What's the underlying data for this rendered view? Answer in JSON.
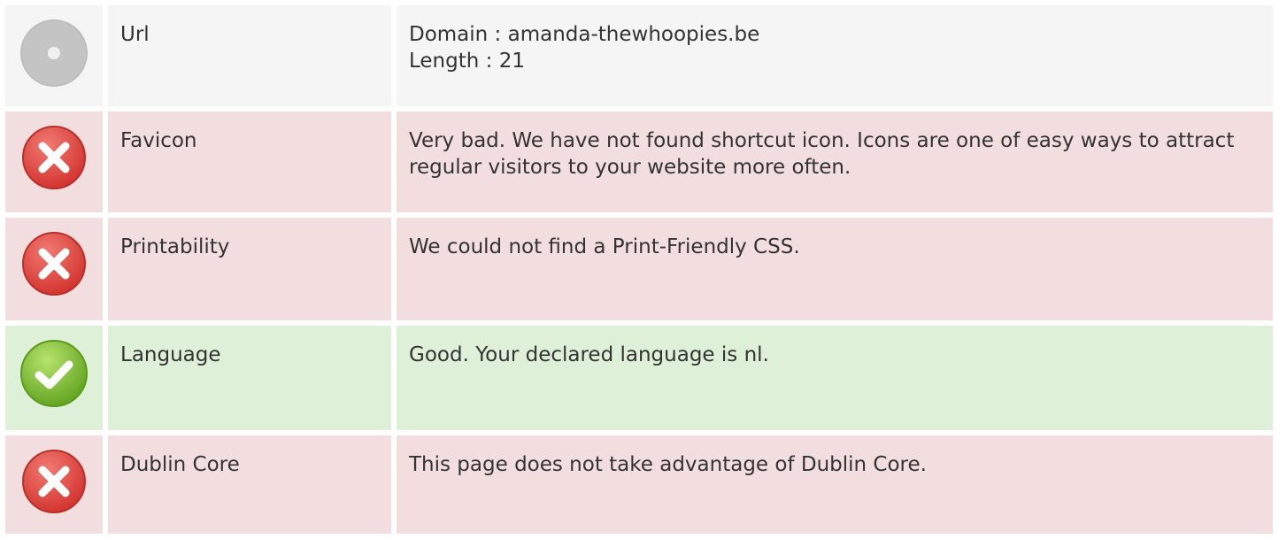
{
  "rows": [
    {
      "status": "neutral",
      "icon": "disc-icon",
      "label": "Url",
      "lines": [
        "Domain : amanda-thewhoopies.be",
        "Length : 21"
      ]
    },
    {
      "status": "bad",
      "icon": "error-x-icon",
      "label": "Favicon",
      "lines": [
        "Very bad. We have not found shortcut icon. Icons are one of easy ways to attract regular visitors to your website more often."
      ]
    },
    {
      "status": "bad",
      "icon": "error-x-icon",
      "label": "Printability",
      "lines": [
        "We could not find a Print-Friendly CSS."
      ]
    },
    {
      "status": "good",
      "icon": "check-icon",
      "label": "Language",
      "lines": [
        "Good. Your declared language is nl."
      ]
    },
    {
      "status": "bad",
      "icon": "error-x-icon",
      "label": "Dublin Core",
      "lines": [
        "This page does not take advantage of Dublin Core."
      ]
    }
  ],
  "colors": {
    "neutral_bg": "#f5f5f5",
    "bad_bg": "#f2dede",
    "good_bg": "#dff0d8",
    "error_red": "#e0403a",
    "success_green": "#7cc72a",
    "disc_gray": "#bdbdbd"
  }
}
